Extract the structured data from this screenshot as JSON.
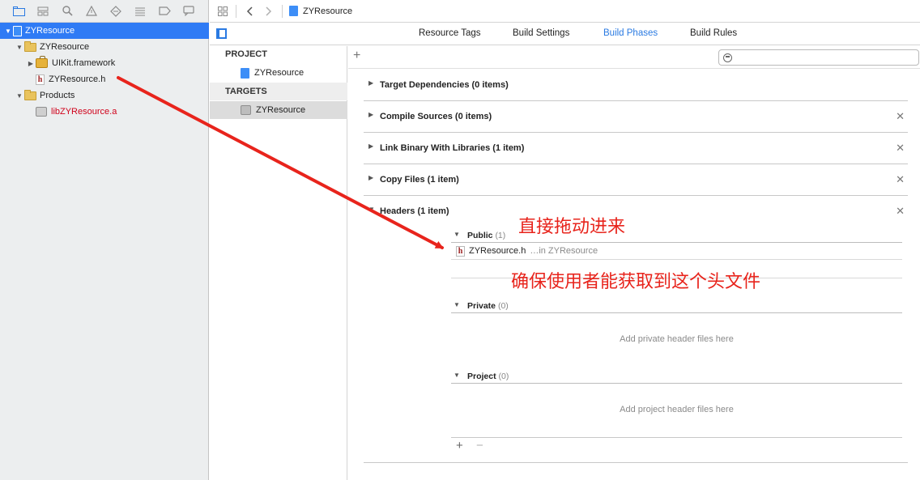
{
  "navigator": {
    "tools": [
      "folder-icon",
      "hierarchy-icon",
      "search-icon",
      "warning-icon",
      "breakpoint-icon",
      "list-icon",
      "tag-icon",
      "chat-icon"
    ],
    "tree": [
      {
        "label": "ZYResource",
        "kind": "project",
        "expanded": true,
        "selected": true
      },
      {
        "label": "ZYResource",
        "kind": "group",
        "expanded": true
      },
      {
        "label": "UIKit.framework",
        "kind": "framework",
        "expanded": false
      },
      {
        "label": "ZYResource.h",
        "kind": "header"
      },
      {
        "label": "Products",
        "kind": "group",
        "expanded": true
      },
      {
        "label": "libZYResource.a",
        "kind": "library",
        "color": "#d0021b"
      }
    ]
  },
  "jump_bar": {
    "file": "ZYResource"
  },
  "tabs": [
    {
      "label": "Resource Tags",
      "active": false
    },
    {
      "label": "Build Settings",
      "active": false
    },
    {
      "label": "Build Phases",
      "active": true
    },
    {
      "label": "Build Rules",
      "active": false
    }
  ],
  "targets_pane": {
    "project_header": "PROJECT",
    "project_item": "ZYResource",
    "targets_header": "TARGETS",
    "target_item": "ZYResource"
  },
  "phases": [
    {
      "title": "Target Dependencies (0 items)",
      "closable": false
    },
    {
      "title": "Compile Sources (0 items)",
      "closable": true
    },
    {
      "title": "Link Binary With Libraries (1 item)",
      "closable": true
    },
    {
      "title": "Copy Files (1 item)",
      "closable": true
    },
    {
      "title": "Headers (1 item)",
      "closable": true
    }
  ],
  "headers": {
    "public_label": "Public",
    "public_count": "(1)",
    "public_file": "ZYResource.h",
    "public_file_location": "…in ZYResource",
    "private_label": "Private",
    "private_count": "(0)",
    "private_placeholder": "Add private header files here",
    "project_label": "Project",
    "project_count": "(0)",
    "project_placeholder": "Add project header files here"
  },
  "annotations": {
    "drag_hint": "直接拖动进来",
    "ensure_hint": "确保使用者能获取到这个头文件"
  },
  "colors": {
    "accent": "#2a7ae2",
    "selection": "#2f7bf5",
    "annotation": "#e8241c"
  }
}
